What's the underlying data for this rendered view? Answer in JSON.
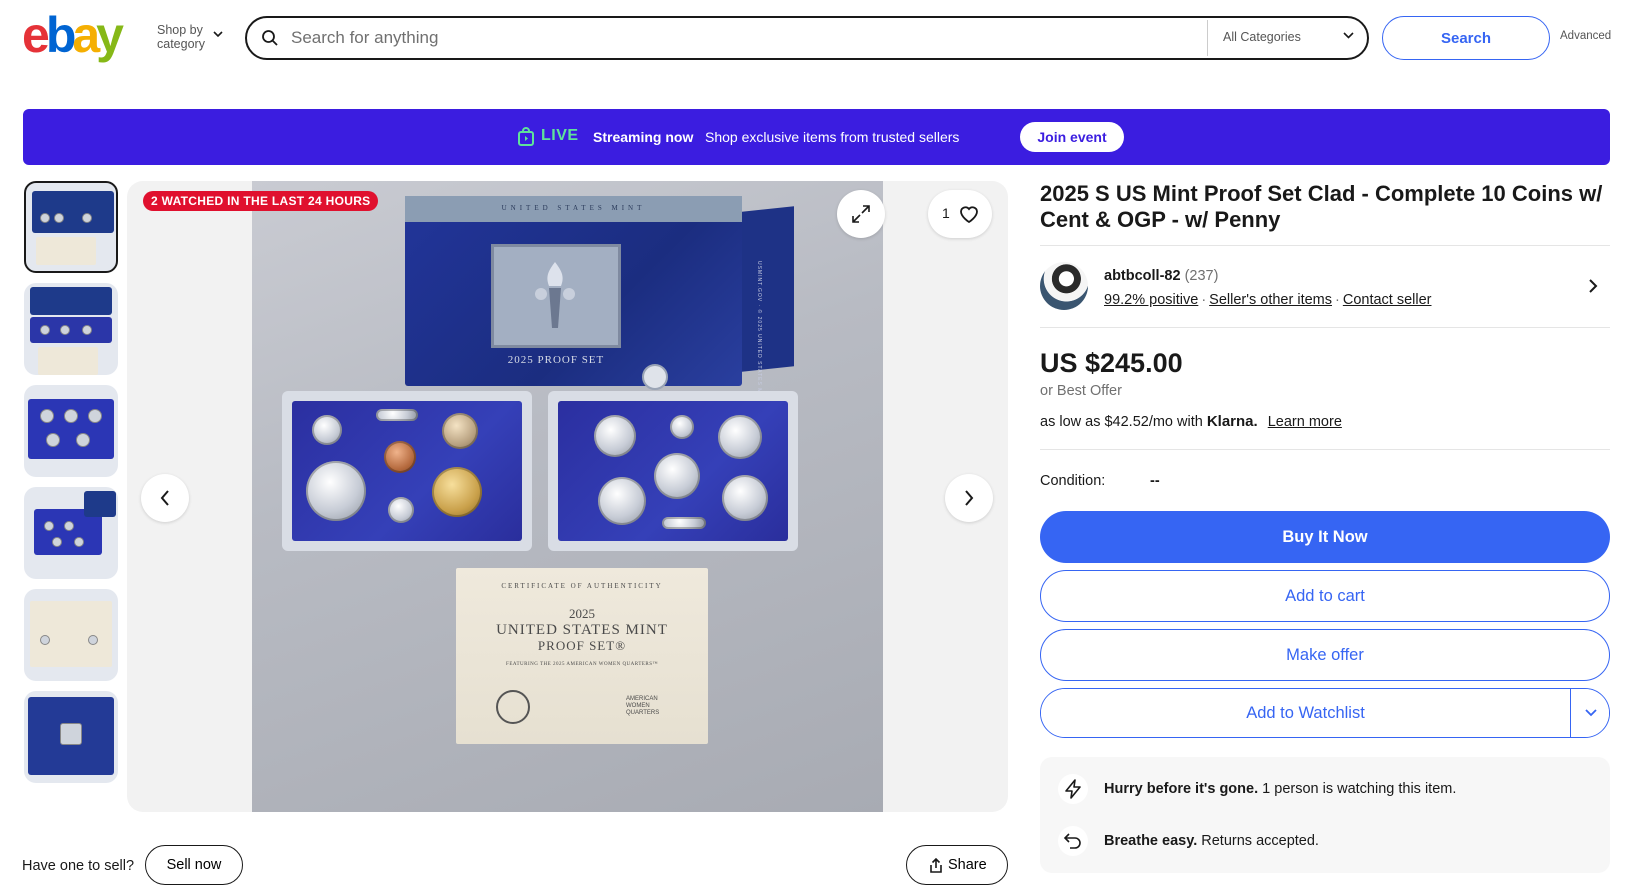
{
  "header": {
    "logo_letters": [
      "e",
      "b",
      "a",
      "y"
    ],
    "logo_colors": [
      "#e53238",
      "#0064d2",
      "#f5af02",
      "#86b817"
    ],
    "shop_by_line1": "Shop by",
    "shop_by_line2": "category",
    "search_placeholder": "Search for anything",
    "category_select": "All Categories",
    "search_button": "Search",
    "advanced_link": "Advanced"
  },
  "banner": {
    "live_label": "LIVE",
    "streaming_label": "Streaming now",
    "description": "Shop exclusive items from trusted sellers",
    "join_button": "Join event",
    "background_color": "#3b1de0"
  },
  "gallery": {
    "watched_badge": "2 WATCHED IN THE LAST 24 HOURS",
    "watch_count": "1",
    "thumbnail_count": 6,
    "selected_thumbnail": 1,
    "photo_texts": {
      "ogp_top": "UNITED STATES MINT",
      "ogp_emblem": "2025 PROOF SET",
      "ogp_side": "USMINT.GOV · © 2025 UNITED STATES MINT",
      "cert_heading": "CERTIFICATE OF AUTHENTICITY",
      "cert_year": "2025",
      "cert_line1": "UNITED STATES MINT",
      "cert_line2": "PROOF SET®",
      "cert_sub": "FEATURING THE 2025 AMERICAN WOMEN QUARTERS™",
      "cert_awq": "AMERICAN WOMEN QUARTERS"
    }
  },
  "sell": {
    "label": "Have one to sell?",
    "button": "Sell now"
  },
  "share_button": "Share",
  "listing": {
    "title": "2025 S US Mint Proof Set Clad - Complete 10 Coins w/ Cent & OGP - w/ Penny",
    "seller_name": "abtbcoll-82",
    "seller_count": "(237)",
    "seller_feedback": "99.2% positive",
    "seller_other_items": "Seller's other items",
    "contact_seller": "Contact seller",
    "price": "US $245.00",
    "best_offer": "or Best Offer",
    "klarna_prefix": "as low as $42.52/mo with",
    "klarna_brand": "Klarna.",
    "learn_more": "Learn more",
    "condition_label": "Condition:",
    "condition_value": "--",
    "buy_it_now": "Buy It Now",
    "add_to_cart": "Add to cart",
    "make_offer": "Make offer",
    "add_to_watchlist": "Add to Watchlist",
    "hurry_bold": "Hurry before it's gone.",
    "hurry_text": "1 person is watching this item.",
    "returns_bold": "Breathe easy.",
    "returns_text": "Returns accepted.",
    "accent_color": "#3665f3"
  }
}
